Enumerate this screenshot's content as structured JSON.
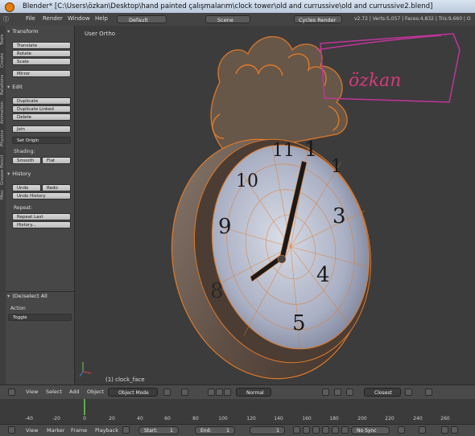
{
  "window": {
    "title": "Blender* [C:\\Users\\özkan\\Desktop\\hand painted çalışmalarım\\clock tower\\old and currussive\\old and currussive2.blend]"
  },
  "menu": {
    "file": "File",
    "render": "Render",
    "window": "Window",
    "help": "Help"
  },
  "infobar": {
    "screen_layout": "Default",
    "scene": "Scene",
    "engine": "Cycles Render",
    "stats": "v2.72 | Verts:5,057 | Faces:4,832 | Tris:9,660 | O"
  },
  "side_tabs": [
    "Tools",
    "Create",
    "Relations",
    "Animation",
    "Physics",
    "Grease Pencil",
    "Misc"
  ],
  "tool_shelf": {
    "transform": {
      "header": "Transform",
      "translate": "Translate",
      "rotate": "Rotate",
      "scale": "Scale",
      "mirror": "Mirror"
    },
    "edit": {
      "header": "Edit",
      "duplicate": "Duplicate",
      "duplicate_linked": "Duplicate Linked",
      "delete": "Delete",
      "join": "Join",
      "set_origin": "Set Origin",
      "shading_label": "Shading:",
      "smooth": "Smooth",
      "flat": "Flat"
    },
    "history": {
      "header": "History",
      "undo": "Undo",
      "redo": "Redo",
      "undo_history": "Undo History",
      "repeat_label": "Repeat:",
      "repeat_last": "Repeat Last",
      "history": "History..."
    }
  },
  "operator_panel": {
    "header": "(De)select All",
    "action_label": "Action",
    "action_value": "Toggle"
  },
  "viewport": {
    "view_label": "User Ortho",
    "object_label": "(1) clock_face",
    "watermark": "özkan",
    "accent": "#e07a2a"
  },
  "view3d_header": {
    "view": "View",
    "select": "Select",
    "add": "Add",
    "object": "Object",
    "mode": "Object Mode",
    "pivot": "Normal",
    "snap": "Closest"
  },
  "timeline": {
    "ticks": [
      "-40",
      "-20",
      "0",
      "20",
      "40",
      "60",
      "80",
      "100",
      "120",
      "140",
      "160",
      "180",
      "200",
      "220",
      "240",
      "260"
    ],
    "current_frame_marker": "0"
  },
  "timeline_header": {
    "view": "View",
    "marker": "Marker",
    "frame": "Frame",
    "playback": "Playback",
    "start": "Start:",
    "start_val": "1",
    "end": "End:",
    "end_val": "1",
    "current": "1",
    "sync": "No Sync"
  }
}
